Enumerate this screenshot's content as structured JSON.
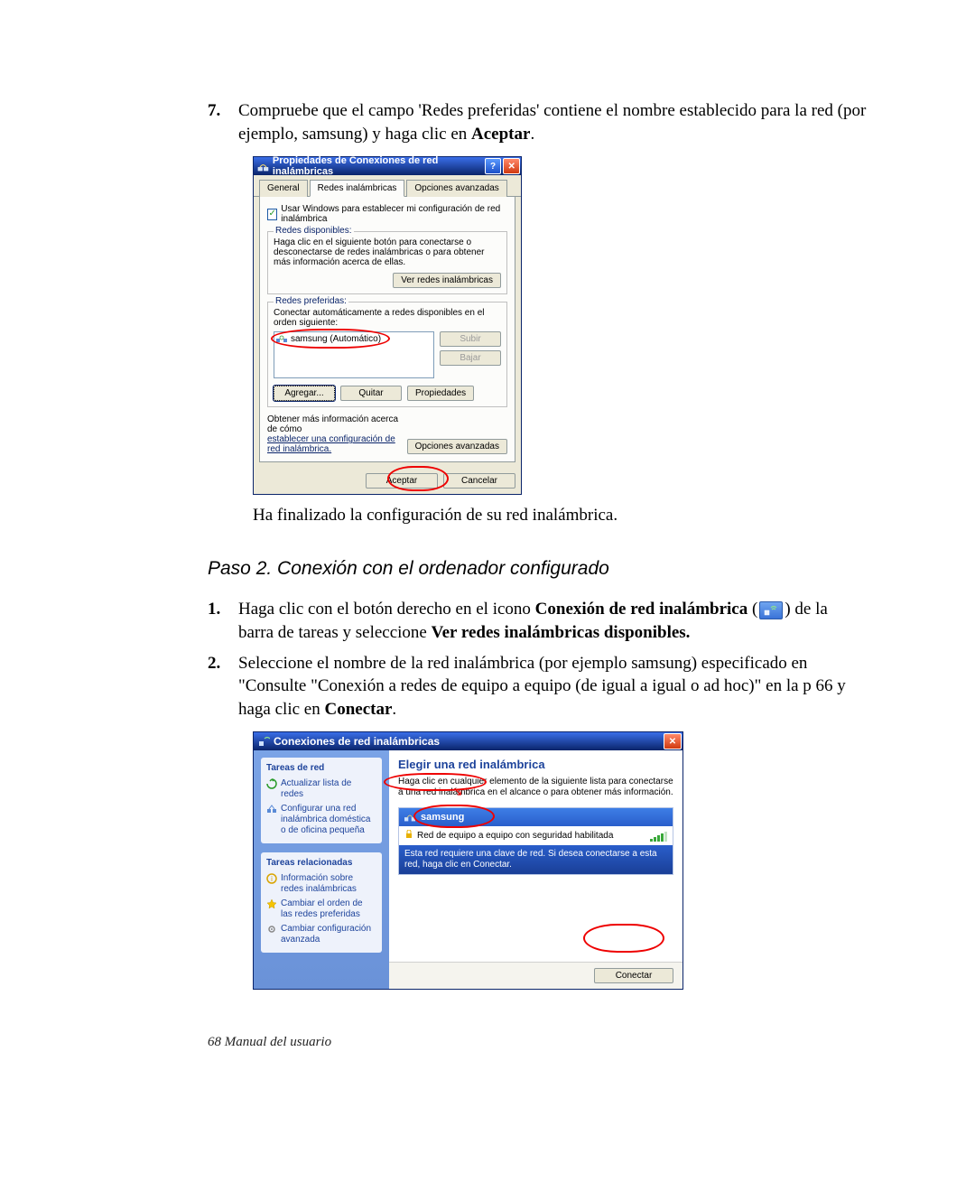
{
  "step7": {
    "num": "7.",
    "text_a": "Compruebe que el campo 'Redes preferidas' contiene el nombre establecido para la red (por ejemplo, samsung) y haga clic en ",
    "text_b": "Aceptar",
    "text_c": "."
  },
  "dlg1": {
    "title": "Propiedades de Conexiones de red inalámbricas",
    "help": "?",
    "close": "✕",
    "tabs": {
      "general": "General",
      "wireless": "Redes inalámbricas",
      "advanced": "Opciones avanzadas"
    },
    "chk_label": "Usar Windows para establecer mi configuración de red inalámbrica",
    "grp_available": {
      "legend": "Redes disponibles:",
      "text": "Haga clic en el siguiente botón para conectarse o desconectarse de redes inalámbricas o para obtener más información acerca de ellas.",
      "btn": "Ver redes inalámbricas"
    },
    "grp_preferred": {
      "legend": "Redes preferidas:",
      "text": "Conectar automáticamente a redes disponibles en el orden siguiente:",
      "item": "samsung (Automático)",
      "btn_up": "Subir",
      "btn_down": "Bajar",
      "btn_add": "Agregar...",
      "btn_remove": "Quitar",
      "btn_props": "Propiedades"
    },
    "info_text": "Obtener más información acerca de cómo",
    "info_link": "establecer una configuración de red inalámbrica.",
    "btn_adv": "Opciones avanzadas",
    "btn_ok": "Aceptar",
    "btn_cancel": "Cancelar"
  },
  "after_dlg1": "Ha finalizado la configuración de su red inalámbrica.",
  "step2_heading": "Paso 2. Conexión con el ordenador configurado",
  "s2_item1": {
    "num": "1.",
    "a": "Haga clic con el botón derecho en el icono ",
    "b": "Conexión de red inalámbrica",
    "c": " (",
    "d": ") de la barra de tareas y seleccione ",
    "e": "Ver redes inalámbricas disponibles."
  },
  "s2_item2": {
    "num": "2.",
    "a": "Seleccione el nombre de la red inalámbrica (por ejemplo samsung) especificado en \"Consulte \"Conexión a redes de equipo a equipo (de igual a igual o ad hoc)\" en la p 66 y haga clic en ",
    "b": "Conectar",
    "c": "."
  },
  "dlg2": {
    "title": "Conexiones de red inalámbricas",
    "close": "✕",
    "side": {
      "h1": "Tareas de red",
      "i1": "Actualizar lista de redes",
      "i2": "Configurar una red inalámbrica doméstica o de oficina pequeña",
      "h2": "Tareas relacionadas",
      "i3": "Información sobre redes inalámbricas",
      "i4": "Cambiar el orden de las redes preferidas",
      "i5": "Cambiar configuración avanzada"
    },
    "main": {
      "title": "Elegir una red inalámbrica",
      "sub": "Haga clic en cualquier elemento de la siguiente lista para conectarse a una red inalámbrica en el alcance o para obtener más información.",
      "net_name": "samsung",
      "net_desc": "Red de equipo a equipo con seguridad habilitada",
      "net_note": "Esta red requiere una clave de red. Si desea conectarse a esta red, haga clic en Conectar.",
      "btn_connect": "Conectar"
    }
  },
  "footer": "68  Manual del usuario"
}
